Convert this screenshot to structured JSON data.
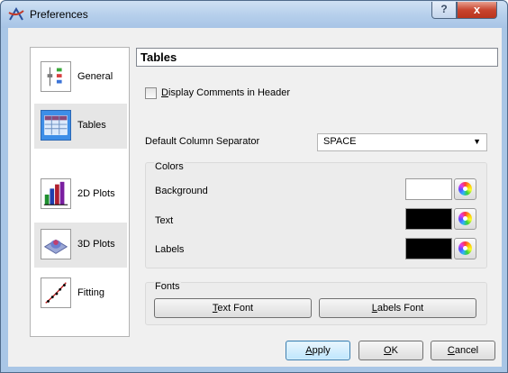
{
  "window": {
    "title": "Preferences",
    "help_glyph": "?",
    "close_glyph": "x"
  },
  "sidebar": {
    "items": [
      {
        "label": "General",
        "icon": "general-settings-icon",
        "selected": false
      },
      {
        "label": "Tables",
        "icon": "table-icon",
        "selected": true
      },
      {
        "label": "2D Plots",
        "icon": "bar-chart-icon",
        "selected": false
      },
      {
        "label": "3D Plots",
        "icon": "surface-plot-icon",
        "selected": false
      },
      {
        "label": "Fitting",
        "icon": "fit-curve-icon",
        "selected": false
      }
    ]
  },
  "panel": {
    "title": "Tables",
    "display_comments": {
      "mnemonic": "D",
      "rest": "isplay Comments in Header",
      "checked": false
    },
    "separator": {
      "label": "Default Column Separator",
      "value": "SPACE"
    },
    "colors": {
      "title": "Colors",
      "rows": [
        {
          "label": "Background",
          "color": "#ffffff"
        },
        {
          "label": "Text",
          "color": "#000000"
        },
        {
          "label": "Labels",
          "color": "#000000"
        }
      ]
    },
    "fonts": {
      "title": "Fonts",
      "text_font": {
        "mnemonic": "T",
        "rest": "ext Font"
      },
      "labels_font": {
        "mnemonic": "L",
        "rest": "abels Font"
      }
    }
  },
  "buttons": {
    "apply": {
      "mnemonic": "A",
      "rest": "pply"
    },
    "ok": {
      "mnemonic": "O",
      "rest": "K"
    },
    "cancel": {
      "mnemonic": "C",
      "rest": "ancel"
    }
  },
  "colors": {
    "selection_accent": "#3d8ee8",
    "close_button": "#c8452f"
  }
}
